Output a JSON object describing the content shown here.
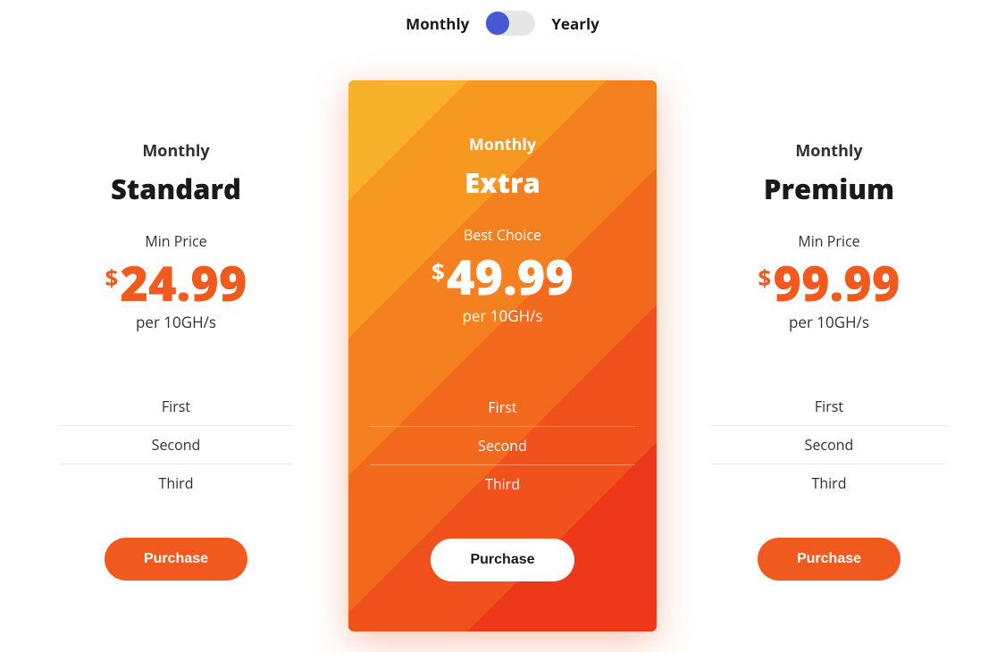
{
  "toggle": {
    "left_label": "Monthly",
    "right_label": "Yearly",
    "state": "monthly"
  },
  "plans": [
    {
      "period": "Monthly",
      "name": "Standard",
      "subtitle": "Min Price",
      "currency": "$",
      "price": "24.99",
      "per": "per 10GH/s",
      "features": [
        "First",
        "Second",
        "Third"
      ],
      "cta": "Purchase",
      "featured": false
    },
    {
      "period": "Monthly",
      "name": "Extra",
      "subtitle": "Best Choice",
      "currency": "$",
      "price": "49.99",
      "per": "per 10GH/s",
      "features": [
        "First",
        "Second",
        "Third"
      ],
      "cta": "Purchase",
      "featured": true
    },
    {
      "period": "Monthly",
      "name": "Premium",
      "subtitle": "Min Price",
      "currency": "$",
      "price": "99.99",
      "per": "per 10GH/s",
      "features": [
        "First",
        "Second",
        "Third"
      ],
      "cta": "Purchase",
      "featured": false
    }
  ],
  "colors": {
    "accent": "#f05a1e",
    "toggle_thumb": "#4658d6"
  }
}
